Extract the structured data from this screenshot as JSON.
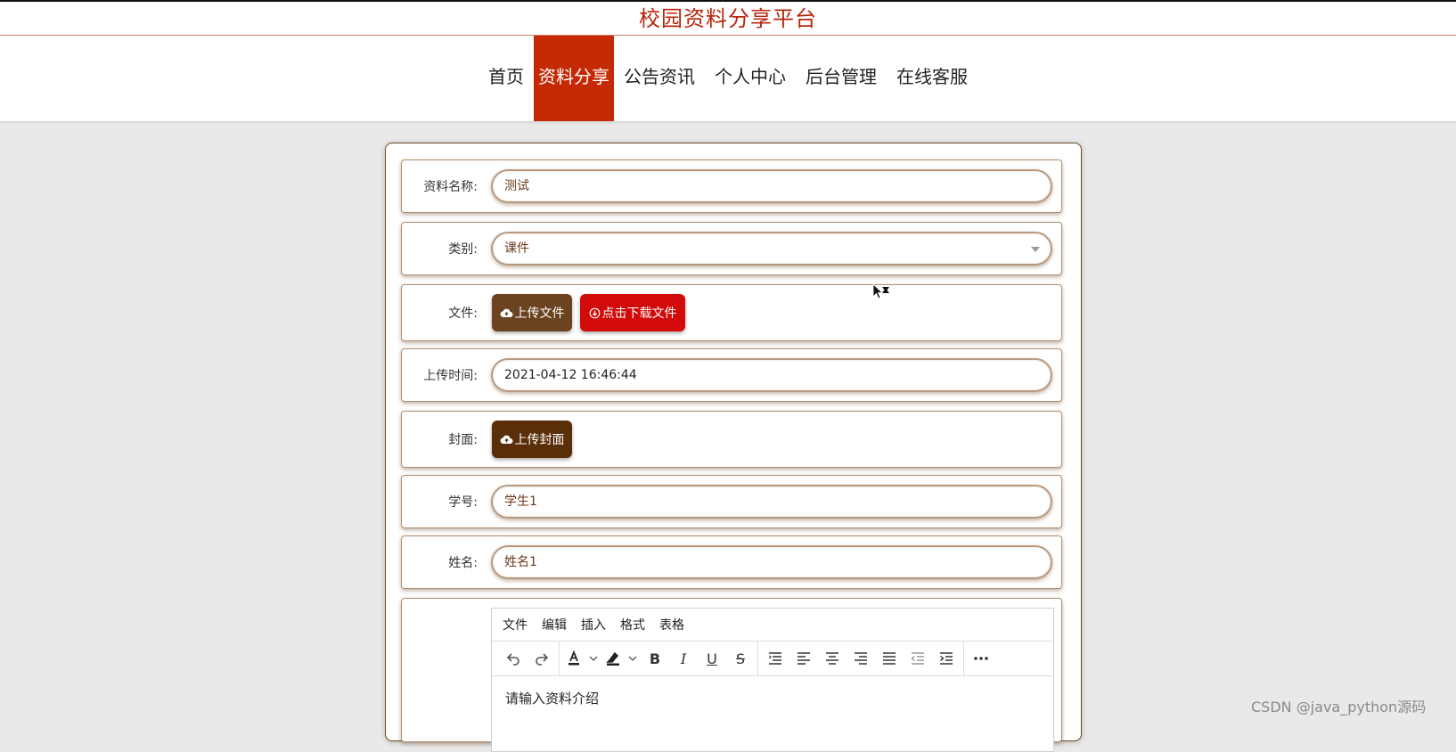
{
  "site": {
    "title": "校园资料分享平台"
  },
  "nav": {
    "items": [
      {
        "label": "首页"
      },
      {
        "label": "资料分享"
      },
      {
        "label": "公告资讯"
      },
      {
        "label": "个人中心"
      },
      {
        "label": "后台管理"
      },
      {
        "label": "在线客服"
      }
    ],
    "active_index": 1
  },
  "form": {
    "name": {
      "label": "资料名称:",
      "value": "测试"
    },
    "category": {
      "label": "类别:",
      "value": "课件"
    },
    "file": {
      "label": "文件:",
      "upload_button": "上传文件",
      "download_button": "点击下载文件"
    },
    "upload_time": {
      "label": "上传时间:",
      "value": "2021-04-12 16:46:44"
    },
    "cover": {
      "label": "封面:",
      "upload_button": "上传封面"
    },
    "student_id": {
      "label": "学号:",
      "value": "学生1"
    },
    "student_name": {
      "label": "姓名:",
      "value": "姓名1"
    }
  },
  "editor": {
    "menu": [
      "文件",
      "编辑",
      "插入",
      "格式",
      "表格"
    ],
    "placeholder": "请输入资料介绍",
    "toolbar_icons": [
      "undo-icon",
      "redo-icon",
      "font-color-icon",
      "highlight-icon",
      "bold-icon",
      "italic-icon",
      "underline-icon",
      "strikethrough-icon",
      "line-height-icon",
      "align-left-icon",
      "align-center-icon",
      "align-right-icon",
      "align-justify-icon",
      "outdent-icon",
      "indent-icon",
      "more-icon"
    ]
  },
  "colors": {
    "brand_red": "#c52a05",
    "upload_brown": "#6b4321",
    "download_red": "#d20a0a",
    "cover_brown": "#5a2e08"
  },
  "watermark": "CSDN @java_python源码"
}
